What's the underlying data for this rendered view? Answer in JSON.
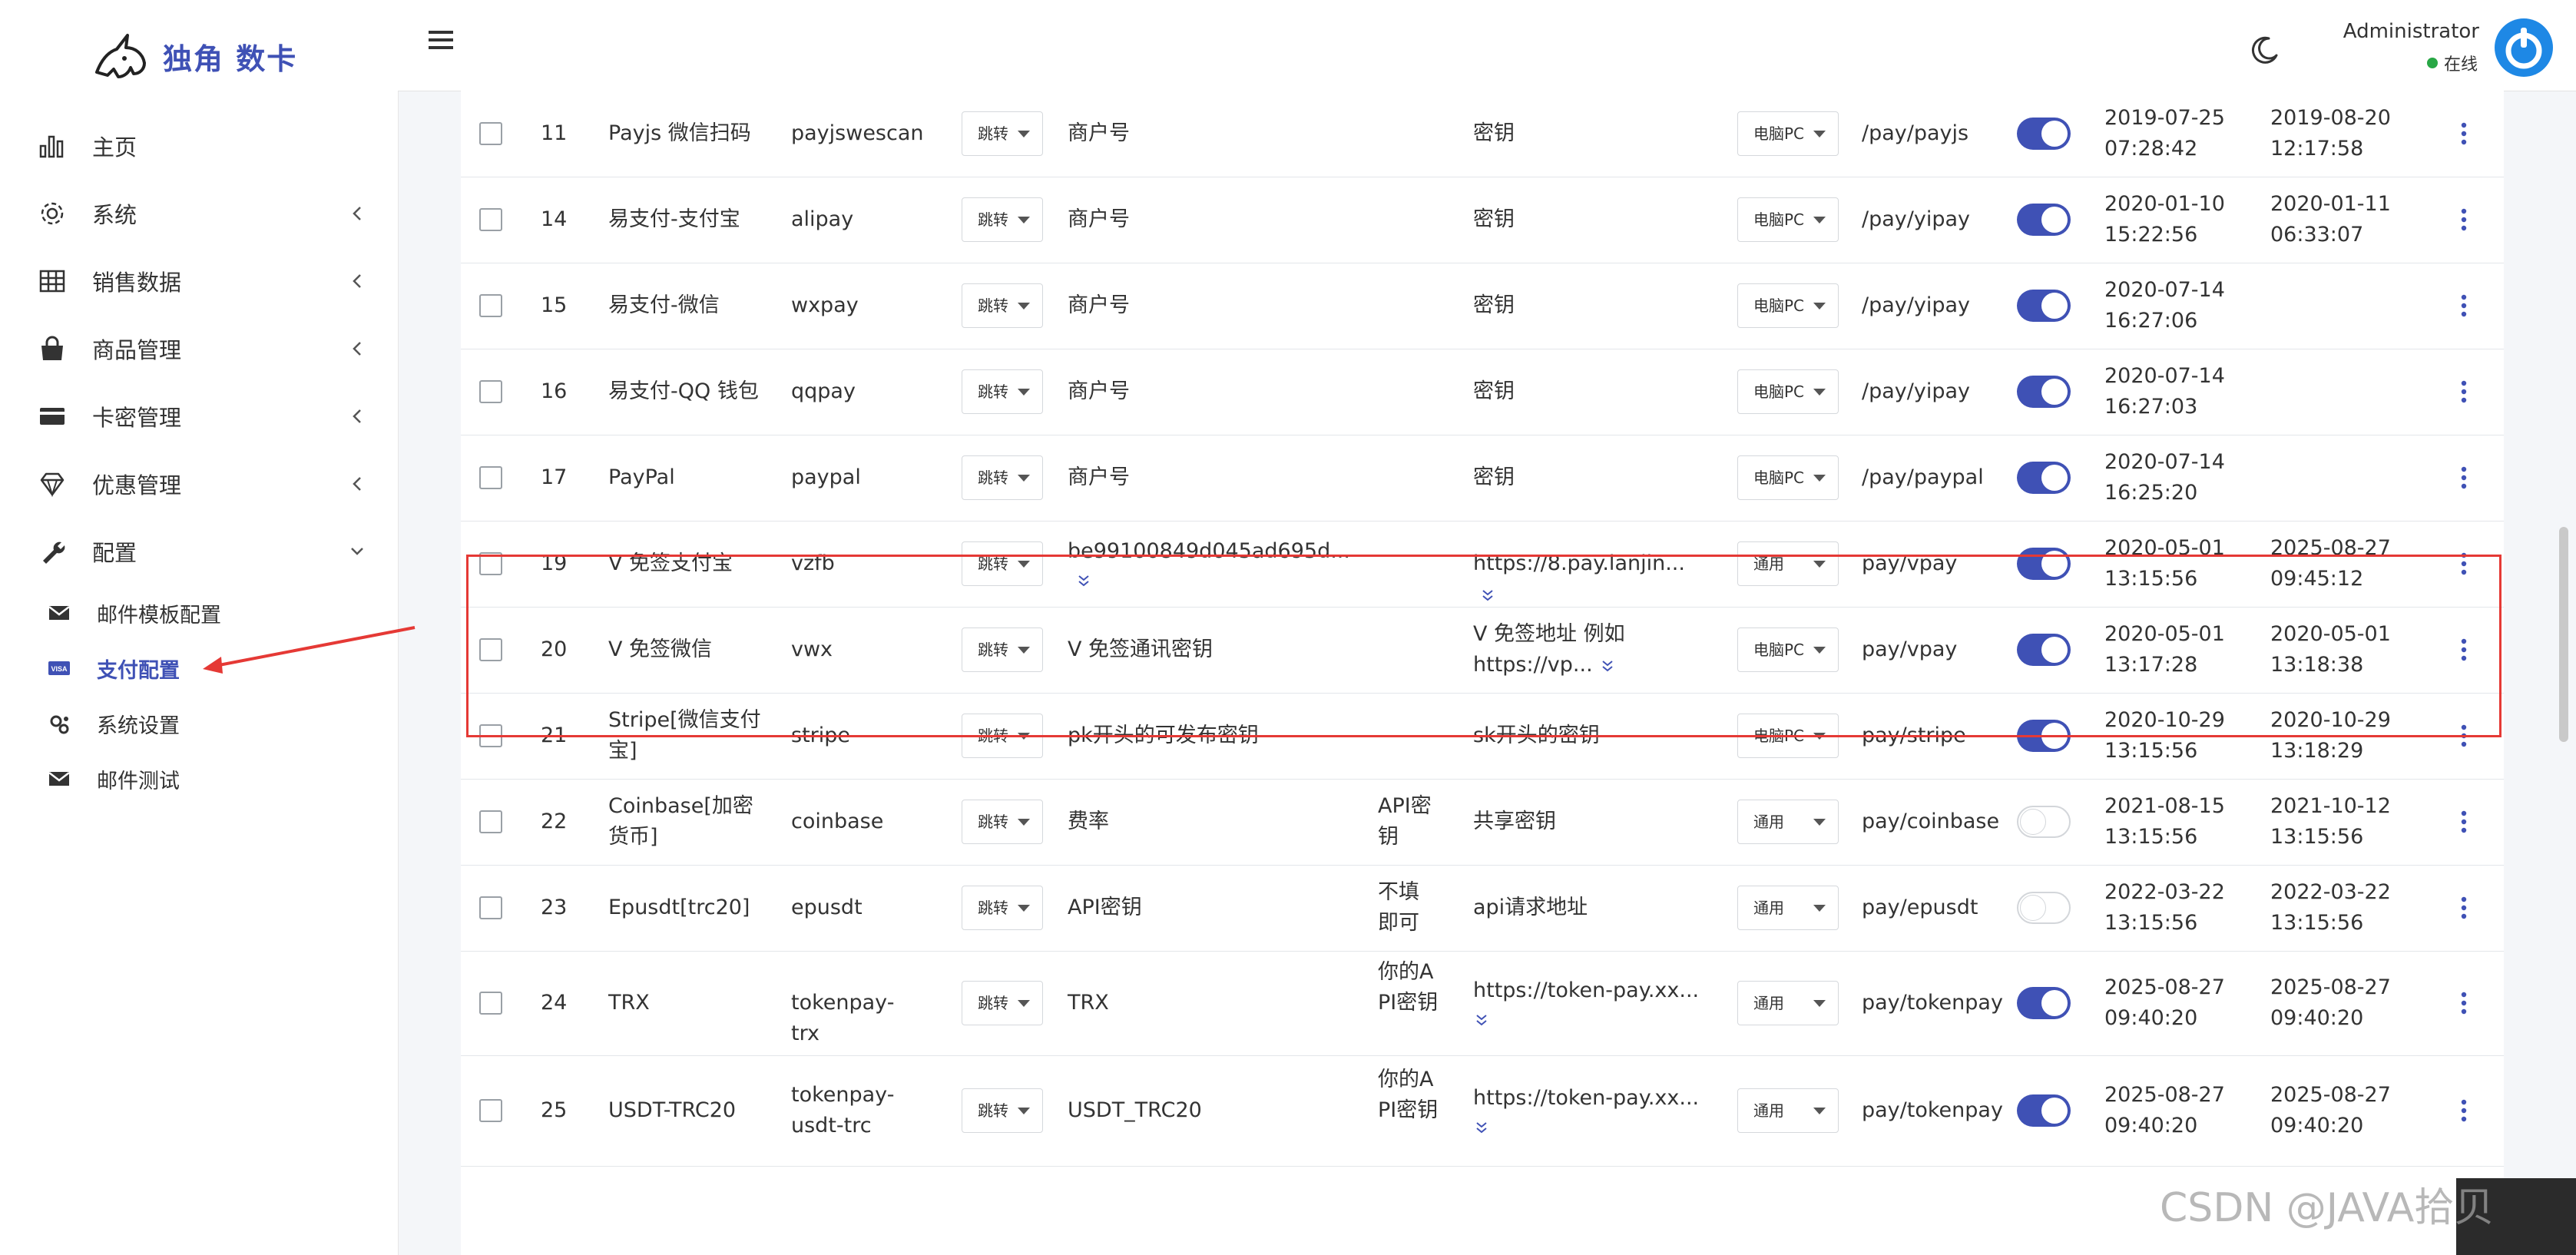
{
  "brand": {
    "name": "独角 数卡"
  },
  "sidebar": {
    "items": [
      {
        "label": "主页",
        "icon": "bar-chart-icon",
        "chevron": ""
      },
      {
        "label": "系统",
        "icon": "gear-icon",
        "chevron": "left"
      },
      {
        "label": "销售数据",
        "icon": "table-icon",
        "chevron": "left"
      },
      {
        "label": "商品管理",
        "icon": "shopping-bag-icon",
        "chevron": "left"
      },
      {
        "label": "卡密管理",
        "icon": "credit-card-icon",
        "chevron": "left"
      },
      {
        "label": "优惠管理",
        "icon": "diamond-icon",
        "chevron": "left"
      },
      {
        "label": "配置",
        "icon": "wrench-icon",
        "chevron": "down"
      }
    ],
    "sub_items": [
      {
        "label": "邮件模板配置",
        "icon": "envelope-icon",
        "active": false
      },
      {
        "label": "支付配置",
        "icon": "visa-card-icon",
        "active": true
      },
      {
        "label": "系统设置",
        "icon": "gears-icon",
        "active": false
      },
      {
        "label": "邮件测试",
        "icon": "envelope-icon",
        "active": false
      }
    ]
  },
  "header": {
    "user_name": "Administrator",
    "user_status": "在线",
    "status_color": "#28a745"
  },
  "colors": {
    "accent": "#3f51b5",
    "highlight_border": "#e53935"
  },
  "table": {
    "rows": [
      {
        "id": "11",
        "name": "Payjs 微信扫码",
        "check": "payjswescan",
        "method": "跳转",
        "merchant_id": "商户号",
        "merchant_id_expand": false,
        "merchant_key": "",
        "secret": "密钥",
        "secret_expand": false,
        "client": "电脑PC",
        "route": "/pay/payjs",
        "enabled": true,
        "created": [
          "2019-07-25",
          "07:28:42"
        ],
        "updated": [
          "2019-08-20",
          "12:17:58"
        ]
      },
      {
        "id": "14",
        "name": "易支付-支付宝",
        "check": "alipay",
        "method": "跳转",
        "merchant_id": "商户号",
        "merchant_id_expand": false,
        "merchant_key": "",
        "secret": "密钥",
        "secret_expand": false,
        "client": "电脑PC",
        "route": "/pay/yipay",
        "enabled": true,
        "created": [
          "2020-01-10",
          "15:22:56"
        ],
        "updated": [
          "2020-01-11",
          "06:33:07"
        ]
      },
      {
        "id": "15",
        "name": "易支付-微信",
        "check": "wxpay",
        "method": "跳转",
        "merchant_id": "商户号",
        "merchant_id_expand": false,
        "merchant_key": "",
        "secret": "密钥",
        "secret_expand": false,
        "client": "电脑PC",
        "route": "/pay/yipay",
        "enabled": true,
        "created": [
          "2020-07-14",
          "16:27:06"
        ],
        "updated": [
          "",
          ""
        ]
      },
      {
        "id": "16",
        "name": "易支付-QQ 钱包",
        "check": "qqpay",
        "method": "跳转",
        "merchant_id": "商户号",
        "merchant_id_expand": false,
        "merchant_key": "",
        "secret": "密钥",
        "secret_expand": false,
        "client": "电脑PC",
        "route": "/pay/yipay",
        "enabled": true,
        "created": [
          "2020-07-14",
          "16:27:03"
        ],
        "updated": [
          "",
          ""
        ]
      },
      {
        "id": "17",
        "name": "PayPal",
        "check": "paypal",
        "method": "跳转",
        "merchant_id": "商户号",
        "merchant_id_expand": false,
        "merchant_key": "",
        "secret": "密钥",
        "secret_expand": false,
        "client": "电脑PC",
        "route": "/pay/paypal",
        "enabled": true,
        "created": [
          "2020-07-14",
          "16:25:20"
        ],
        "updated": [
          "",
          ""
        ]
      },
      {
        "id": "19",
        "name": "V 免签支付宝",
        "check": "vzfb",
        "method": "跳转",
        "merchant_id": "be99100849d045ad695d...",
        "merchant_id_expand": true,
        "merchant_key": "",
        "secret": "https://8.pay.lanjin...",
        "secret_expand": true,
        "client": "通用",
        "route": "pay/vpay",
        "enabled": true,
        "created": [
          "2020-05-01",
          "13:15:56"
        ],
        "updated": [
          "2025-08-27",
          "09:45:12"
        ]
      },
      {
        "id": "20",
        "name": "V 免签微信",
        "check": "vwx",
        "method": "跳转",
        "merchant_id": "V 免签通讯密钥",
        "merchant_id_expand": false,
        "merchant_key": "",
        "secret": "V 免签地址 例如 https://vp...",
        "secret_expand": true,
        "client": "电脑PC",
        "route": "pay/vpay",
        "enabled": true,
        "created": [
          "2020-05-01",
          "13:17:28"
        ],
        "updated": [
          "2020-05-01",
          "13:18:38"
        ]
      },
      {
        "id": "21",
        "name": "Stripe[微信支付宝]",
        "check": "stripe",
        "method": "跳转",
        "merchant_id": "pk开头的可发布密钥",
        "merchant_id_expand": false,
        "merchant_key": "",
        "secret": "sk开头的密钥",
        "secret_expand": false,
        "client": "电脑PC",
        "route": "pay/stripe",
        "enabled": true,
        "created": [
          "2020-10-29",
          "13:15:56"
        ],
        "updated": [
          "2020-10-29",
          "13:18:29"
        ]
      },
      {
        "id": "22",
        "name": "Coinbase[加密货币]",
        "check": "coinbase",
        "method": "跳转",
        "merchant_id": "费率",
        "merchant_id_expand": false,
        "merchant_key": "API密钥",
        "secret": "共享密钥",
        "secret_expand": false,
        "client": "通用",
        "route": "pay/coinbase",
        "enabled": false,
        "created": [
          "2021-08-15",
          "13:15:56"
        ],
        "updated": [
          "2021-10-12",
          "13:15:56"
        ]
      },
      {
        "id": "23",
        "name": "Epusdt[trc20]",
        "check": "epusdt",
        "method": "跳转",
        "merchant_id": "API密钥",
        "merchant_id_expand": false,
        "merchant_key": "不填即可",
        "secret": "api请求地址",
        "secret_expand": false,
        "client": "通用",
        "route": "pay/epusdt",
        "enabled": false,
        "created": [
          "2022-03-22",
          "13:15:56"
        ],
        "updated": [
          "2022-03-22",
          "13:15:56"
        ]
      },
      {
        "id": "24",
        "name": "TRX",
        "check": "tokenpay-trx",
        "method": "跳转",
        "merchant_id": "TRX",
        "merchant_id_expand": false,
        "merchant_key": "你的API密钥",
        "secret": "https://token-pay.xx...",
        "secret_expand": true,
        "client": "通用",
        "route": "pay/tokenpay",
        "enabled": true,
        "created": [
          "2025-08-27",
          "09:40:20"
        ],
        "updated": [
          "2025-08-27",
          "09:40:20"
        ]
      },
      {
        "id": "25",
        "name": "USDT-TRC20",
        "check": "tokenpay-usdt-trc",
        "method": "跳转",
        "merchant_id": "USDT_TRC20",
        "merchant_id_expand": false,
        "merchant_key": "你的API密钥",
        "secret": "https://token-pay.xx...",
        "secret_expand": true,
        "client": "通用",
        "route": "pay/tokenpay",
        "enabled": true,
        "created": [
          "2025-08-27",
          "09:40:20"
        ],
        "updated": [
          "2025-08-27",
          "09:40:20"
        ]
      }
    ]
  },
  "watermark": "CSDN @JAVA拾贝"
}
